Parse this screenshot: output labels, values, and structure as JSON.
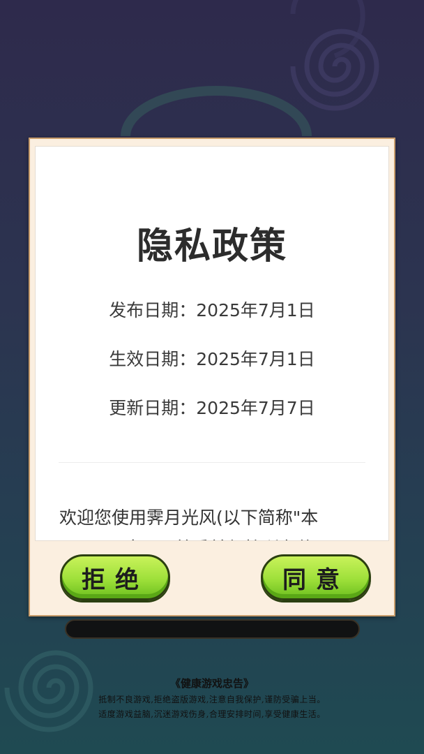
{
  "dialog": {
    "title": "隐私政策",
    "publish_date": "发布日期：2025年7月1日",
    "effective_date": "生效日期：2025年7月1日",
    "update_date": "更新日期：2025年7月7日",
    "intro_line1": "欢迎您使用霁月光风(以下简称\"本",
    "intro_line2": "app\")。本app尊重并保护所有使用",
    "reject_label": "拒绝",
    "agree_label": "同意"
  },
  "notice": {
    "title": "《健康游戏忠告》",
    "line1": "抵制不良游戏,拒绝盗版游戏,注意自我保护,谨防受骗上当。",
    "line2": "适度游戏益脑,沉迷游戏伤身,合理安排时间,享受健康生活。"
  },
  "colors": {
    "button_green": "#9ee03a",
    "dialog_bg": "#fbefe0",
    "dialog_border": "#c89c6a"
  }
}
